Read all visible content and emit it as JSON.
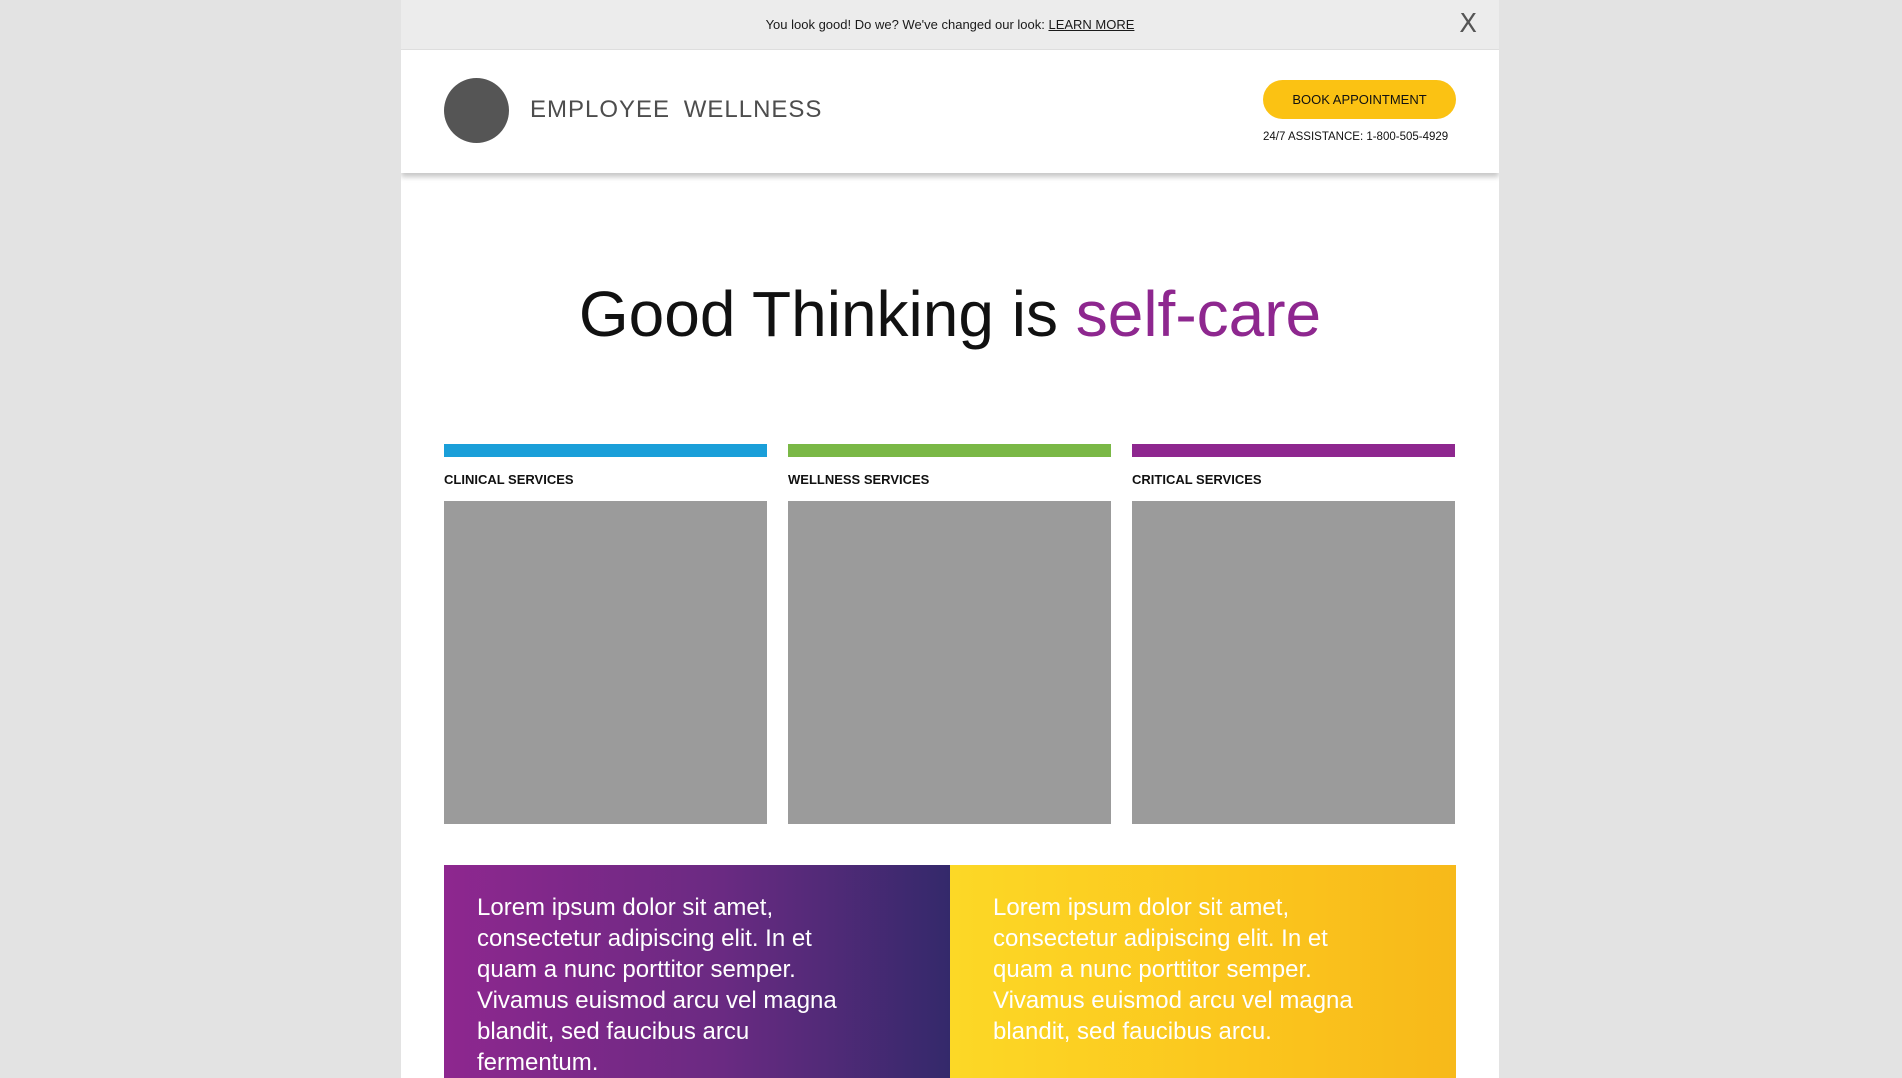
{
  "announcement": {
    "text": "You look good! Do we? We've changed our look: ",
    "link_label": "LEARN MORE",
    "close_label": "X"
  },
  "header": {
    "brand": "EMPLOYEE  WELLNESS",
    "book_button_label": "BOOK APPOINTMENT",
    "assistance": "24/7 ASSISTANCE: 1-800-505-4929"
  },
  "hero": {
    "title_main": "Good Thinking is ",
    "title_accent": "self-care"
  },
  "services": [
    {
      "label": "CLINICAL SERVICES",
      "color": "#1a9fd9"
    },
    {
      "label": "WELLNESS SERVICES",
      "color": "#7ab846"
    },
    {
      "label": "CRITICAL SERVICES",
      "color": "#8e278f"
    }
  ],
  "promos": {
    "left_text": "Lorem ipsum dolor sit amet, consectetur adipiscing elit. In et quam a nunc porttitor semper. Vivamus euismod arcu vel magna blandit, sed faucibus arcu fermentum.",
    "right_text": "Lorem ipsum dolor sit amet, consectetur adipiscing elit. In et quam a nunc porttitor semper. Vivamus euismod arcu vel magna blandit, sed faucibus arcu."
  },
  "colors": {
    "accent_purple": "#8e278f",
    "button_yellow": "#fbc213",
    "clinical_blue": "#1a9fd9",
    "wellness_green": "#7ab846"
  }
}
